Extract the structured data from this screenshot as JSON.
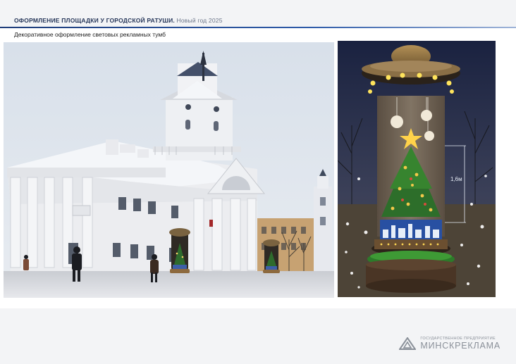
{
  "header": {
    "title": "ОФОРМЛЕНИЕ ПЛОЩАДКИ У ГОРОДСКОЙ РАТУШИ.",
    "subtitle": "Новый год 2025"
  },
  "section": {
    "caption": "Декоративное оформление световых рекламных тумб"
  },
  "mockup": {
    "height_label": "1,6м"
  },
  "brand": {
    "organization_type": "ГОСУДАРСТВЕННОЕ ПРЕДПРИЯТИЕ",
    "name": "МИНСКРЕКЛАМА"
  },
  "colors": {
    "accent": "#1f3d7a",
    "brand_gray": "#8a9099"
  }
}
